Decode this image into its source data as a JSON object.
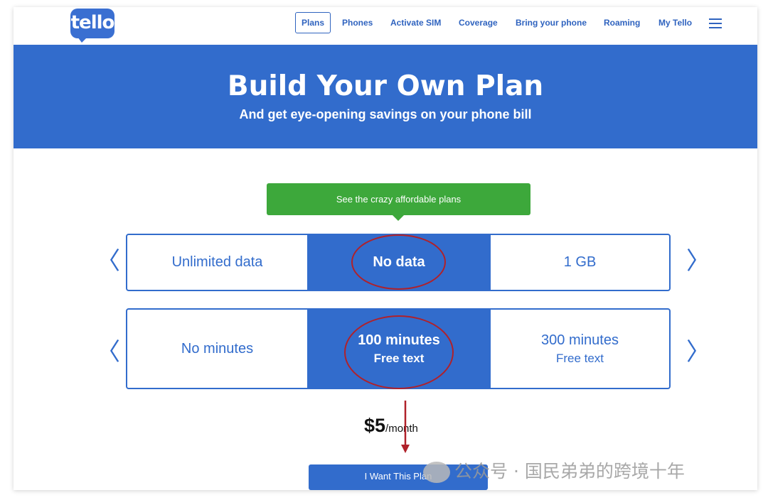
{
  "nav": {
    "logo": "tello",
    "items": [
      "Plans",
      "Phones",
      "Activate SIM",
      "Coverage",
      "Bring your phone",
      "Roaming",
      "My Tello"
    ]
  },
  "hero": {
    "title": "Build Your Own Plan",
    "subtitle": "And get eye-opening savings on your phone bill"
  },
  "banner": "See the crazy affordable plans",
  "data_selector": {
    "left": "Unlimited data",
    "selected": "No data",
    "right": "1 GB"
  },
  "minutes_selector": {
    "left": "No minutes",
    "selected": "100 minutes",
    "selected_sub": "Free text",
    "right": "300 minutes",
    "right_sub": "Free text"
  },
  "price": {
    "amount": "$5",
    "period": "/month"
  },
  "cta": "I Want This Plan",
  "watermark": "公众号 · 国民弟弟的跨境十年",
  "colors": {
    "brand_blue": "#326ccc",
    "banner_green": "#3da83b",
    "annotation_red": "#b0212a"
  }
}
